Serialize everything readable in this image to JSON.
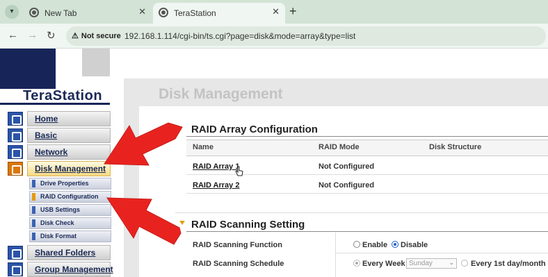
{
  "browser": {
    "tabs": [
      {
        "title": "New Tab",
        "active": false
      },
      {
        "title": "TeraStation",
        "active": true
      }
    ],
    "new_tab_label": "+",
    "security_label": "Not secure",
    "url": "192.168.1.114/cgi-bin/ts.cgi?page=disk&mode=array&type=list",
    "nav_icons": [
      "back-arrow-icon",
      "forward-arrow-icon",
      "reload-icon"
    ]
  },
  "logo": {
    "text": "TeraStation"
  },
  "sidebar": {
    "items": [
      {
        "label": "Home",
        "icon": "home-icon",
        "active": false
      },
      {
        "label": "Basic",
        "icon": "basic-icon",
        "active": false
      },
      {
        "label": "Network",
        "icon": "network-icon",
        "active": false
      },
      {
        "label": "Disk Management",
        "icon": "disk-icon",
        "active": true
      },
      {
        "label": "Shared Folders",
        "icon": "folders-icon",
        "active": false
      },
      {
        "label": "Group Management",
        "icon": "group-icon",
        "active": false
      }
    ],
    "subitems": [
      {
        "label": "Drive Properties",
        "current": false
      },
      {
        "label": "RAID Configuration",
        "current": true
      },
      {
        "label": "USB Settings",
        "current": false
      },
      {
        "label": "Disk Check",
        "current": false
      },
      {
        "label": "Disk Format",
        "current": false
      }
    ]
  },
  "main": {
    "page_title": "Disk Management",
    "raid_config": {
      "title": "RAID Array Configuration",
      "columns": [
        "Name",
        "RAID Mode",
        "Disk Structure"
      ],
      "rows": [
        {
          "name": "RAID Array 1",
          "mode": "Not Configured",
          "structure": ""
        },
        {
          "name": "RAID Array 2",
          "mode": "Not Configured",
          "structure": ""
        }
      ]
    },
    "raid_scanning": {
      "title": "RAID Scanning Setting",
      "function_label": "RAID Scanning Function",
      "function_options": [
        {
          "label": "Enable",
          "selected": false
        },
        {
          "label": "Disable",
          "selected": true
        }
      ],
      "schedule_label": "RAID Scanning Schedule",
      "schedule_options": [
        {
          "label": "Every Week",
          "selected": true
        },
        {
          "label": "Every 1st day/month",
          "selected": false
        }
      ],
      "day_select_value": "Sunday"
    }
  },
  "annotations": {
    "arrow_color": "#e8231f"
  }
}
